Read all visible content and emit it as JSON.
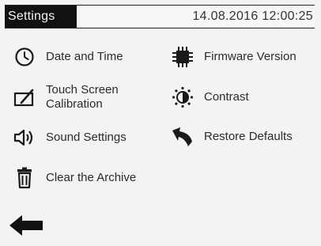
{
  "header": {
    "title": "Settings",
    "datetime": "14.08.2016 12:00:25"
  },
  "menu": {
    "date_time": "Date and Time",
    "touch_line1": "Touch Screen",
    "touch_line2": "Calibration",
    "sound": "Sound Settings",
    "archive": "Clear the Archive",
    "firmware": "Firmware Version",
    "contrast": "Contrast",
    "restore": "Restore Defaults"
  },
  "icons": {
    "date_time": "clock-icon",
    "touch": "touch-calibration-icon",
    "sound": "speaker-icon",
    "archive": "trash-icon",
    "firmware": "chip-icon",
    "contrast": "sun-contrast-icon",
    "restore": "restore-arrow-icon",
    "back": "back-arrow-icon"
  },
  "colors": {
    "background": "#f3f3f1",
    "title_bg": "#111111",
    "icon": "#1a1a1a"
  }
}
